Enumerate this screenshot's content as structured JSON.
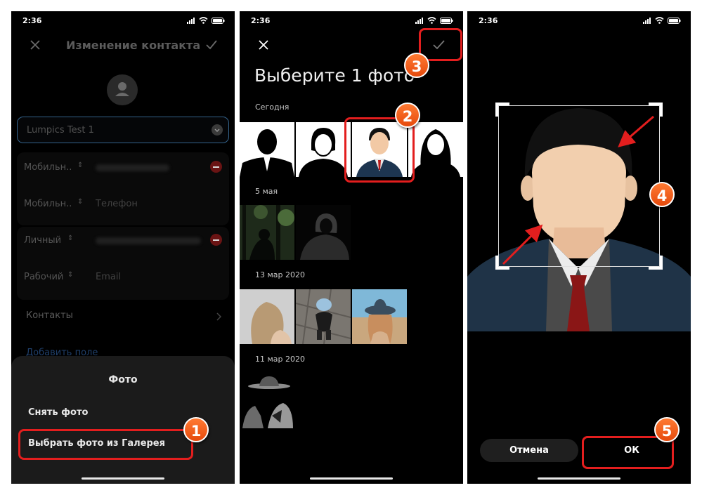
{
  "status_time": "2:36",
  "colors": {
    "accent": "#e31e1e",
    "badge": "#f2611d",
    "link": "#2f6bc4",
    "sheet": "#1b1b1b"
  },
  "icons": [
    "close-icon",
    "check-icon",
    "signal-icon",
    "wifi-icon",
    "battery-icon",
    "chevron-down-icon",
    "remove-icon",
    "chevron-right-icon",
    "avatar-icon"
  ],
  "screen1": {
    "title": "Изменение контакта",
    "name_value": "Lumpics Test 1",
    "fields": [
      {
        "label": "Мобильн..",
        "placeholder": ""
      },
      {
        "label": "Мобильн..",
        "placeholder": "Телефон"
      },
      {
        "label": "Личный",
        "placeholder": ""
      },
      {
        "label": "Рабочий",
        "placeholder": "Email"
      }
    ],
    "contacts_label": "Контакты",
    "add_field": "Добавить поле",
    "sheet": {
      "title": "Фото",
      "take_photo": "Снять фото",
      "choose_gallery": "Выбрать фото из Галерея"
    }
  },
  "screen2": {
    "title": "Выберите 1 фото",
    "sections": [
      "Сегодня",
      "5 мая",
      "13 мар 2020",
      "11 мар 2020"
    ]
  },
  "screen3": {
    "cancel": "Отмена",
    "ok": "ОК"
  },
  "badges": [
    "1",
    "2",
    "3",
    "4",
    "5"
  ]
}
